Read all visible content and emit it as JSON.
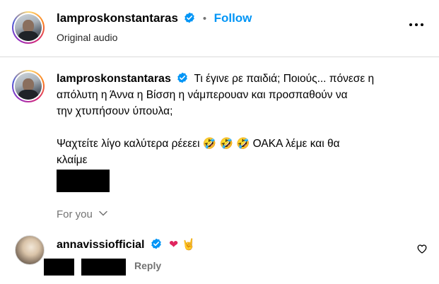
{
  "header": {
    "username": "lamproskonstantaras",
    "separator": "•",
    "follow_label": "Follow",
    "subtitle": "Original audio"
  },
  "caption": {
    "username": "lamproskonstantaras",
    "line1": "Τι έγινε ρε παιδιά; Ποιούς... πόνεσε η",
    "line2": "απόλυτη η Άννα η Βίσση η νάμπερουαν και προσπαθούν να",
    "line3": "την χτυπήσουν ύπουλα;",
    "line4": "Ψαχτείτε λίγο καλύτερα ρέεεει 🤣 🤣 🤣 ΟΑΚΑ λέμε και θα",
    "line5": "κλαίμε"
  },
  "for_you": {
    "label": "For you"
  },
  "comment": {
    "username": "annavissiofficial",
    "text": "❤ 🤘",
    "reply_label": "Reply"
  },
  "colors": {
    "verified": "#0095f6",
    "follow": "#0095f6",
    "secondary_text": "#737373",
    "heart_emoji": "#e0245e"
  }
}
